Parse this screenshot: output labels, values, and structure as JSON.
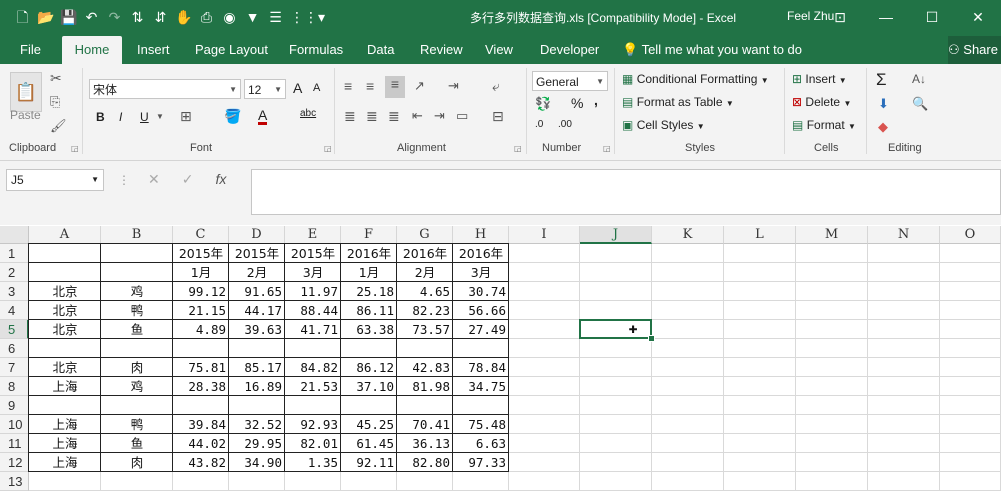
{
  "window": {
    "title": "多行多列数据查询.xls  [Compatibility Mode] - Excel",
    "user": "Feel Zhu",
    "share": "Share"
  },
  "tabs": [
    {
      "label": "File"
    },
    {
      "label": "Home"
    },
    {
      "label": "Insert"
    },
    {
      "label": "Page Layout"
    },
    {
      "label": "Formulas"
    },
    {
      "label": "Data"
    },
    {
      "label": "Review"
    },
    {
      "label": "View"
    },
    {
      "label": "Developer"
    }
  ],
  "tell_me": "Tell me what you want to do",
  "ribbon": {
    "clipboard": {
      "label": "Clipboard",
      "paste": "Paste"
    },
    "font": {
      "label": "Font",
      "name": "宋体",
      "size": "12",
      "bold": "B",
      "italic": "I",
      "underline": "U",
      "font_color_glyph": "A",
      "grow_glyph": "A",
      "shrink_glyph": "A",
      "phonetic_glyph": "abc"
    },
    "alignment": {
      "label": "Alignment"
    },
    "number": {
      "label": "Number",
      "format": "General",
      "percent": "%",
      "comma": ",",
      "inc_dec": ".0←\n.00",
      "dec_dec": ".00→\n.0",
      "inc_dec_short": ".0",
      "dec_dec_short": ".00"
    },
    "styles": {
      "label": "Styles",
      "conditional": "Conditional Formatting",
      "format_table": "Format as Table",
      "cell_styles": "Cell Styles"
    },
    "cells": {
      "label": "Cells",
      "insert": "Insert",
      "delete": "Delete",
      "format": "Format"
    },
    "editing": {
      "label": "Editing"
    }
  },
  "formula_bar": {
    "name_box": "J5",
    "formula": "",
    "fx": "fx"
  },
  "columns": [
    "A",
    "B",
    "C",
    "D",
    "E",
    "F",
    "G",
    "H",
    "I",
    "J",
    "K",
    "L",
    "M",
    "N",
    "O"
  ],
  "selected_column": "J",
  "rows": [
    "1",
    "2",
    "3",
    "4",
    "5",
    "6",
    "7",
    "8",
    "9",
    "10",
    "11",
    "12",
    "13"
  ],
  "selected_row": "5",
  "sheet": {
    "header1": [
      "",
      "",
      "2015年",
      "2015年",
      "2015年",
      "2016年",
      "2016年",
      "2016年"
    ],
    "header2": [
      "",
      "",
      "1月",
      "2月",
      "3月",
      "1月",
      "2月",
      "3月"
    ],
    "data": [
      {
        "row": 3,
        "city": "北京",
        "item": "鸡",
        "values": [
          "99.12",
          "91.65",
          "11.97",
          "25.18",
          "4.65",
          "30.74"
        ]
      },
      {
        "row": 4,
        "city": "北京",
        "item": "鸭",
        "values": [
          "21.15",
          "44.17",
          "88.44",
          "86.11",
          "82.23",
          "56.66"
        ]
      },
      {
        "row": 5,
        "city": "北京",
        "item": "鱼",
        "values": [
          "4.89",
          "39.63",
          "41.71",
          "63.38",
          "73.57",
          "27.49"
        ]
      },
      {
        "row": 7,
        "city": "北京",
        "item": "肉",
        "values": [
          "75.81",
          "85.17",
          "84.82",
          "86.12",
          "42.83",
          "78.84"
        ]
      },
      {
        "row": 8,
        "city": "上海",
        "item": "鸡",
        "values": [
          "28.38",
          "16.89",
          "21.53",
          "37.10",
          "81.98",
          "34.75"
        ]
      },
      {
        "row": 10,
        "city": "上海",
        "item": "鸭",
        "values": [
          "39.84",
          "32.52",
          "92.93",
          "45.25",
          "70.41",
          "75.48"
        ]
      },
      {
        "row": 11,
        "city": "上海",
        "item": "鱼",
        "values": [
          "44.02",
          "29.95",
          "82.01",
          "61.45",
          "36.13",
          "6.63"
        ]
      },
      {
        "row": 12,
        "city": "上海",
        "item": "肉",
        "values": [
          "43.82",
          "34.90",
          "1.35",
          "92.11",
          "82.80",
          "97.33"
        ]
      }
    ]
  }
}
